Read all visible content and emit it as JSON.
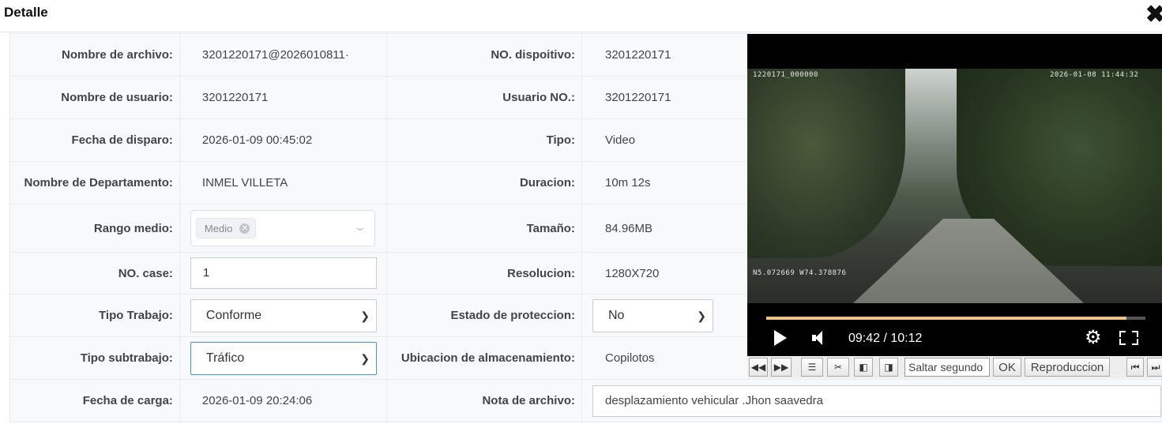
{
  "dialog": {
    "title": "Detalle",
    "close_icon": "close-icon"
  },
  "form": {
    "left": [
      {
        "label": "Nombre de archivo:",
        "value": "3201220171@2026010811·"
      },
      {
        "label": "Nombre de usuario:",
        "value": "3201220171"
      },
      {
        "label": "Fecha de disparo:",
        "value": "2026-01-09 00:45:02"
      },
      {
        "label": "Nombre de Departamento:",
        "value": "INMEL VILLETA"
      },
      {
        "label": "Rango medio:",
        "tag": "Medio"
      },
      {
        "label": "NO. case:",
        "value": "1"
      },
      {
        "label": "Tipo Trabajo:",
        "value": "Conforme"
      },
      {
        "label": "Tipo subtrabajo:",
        "value": "Tráfico"
      },
      {
        "label": "Fecha de carga:",
        "value": "2026-01-09 20:24:06"
      }
    ],
    "right": [
      {
        "label": "NO. dispoitivo:",
        "value": "3201220171"
      },
      {
        "label": "Usuario NO.:",
        "value": "3201220171"
      },
      {
        "label": "Tipo:",
        "value": "Video"
      },
      {
        "label": "Duracion:",
        "value": "10m 12s"
      },
      {
        "label": "Tamaño:",
        "value": "84.96MB"
      },
      {
        "label": "Resolucion:",
        "value": "1280X720"
      },
      {
        "label": "Estado de proteccion:",
        "value": "No"
      },
      {
        "label": "Ubicacion de almacenamiento:",
        "value": "Copilotos"
      },
      {
        "label": "Nota de archivo:",
        "value": "desplazamiento vehicular .Jhon saavedra"
      }
    ]
  },
  "video": {
    "osd_top_left": "1220171_000000",
    "osd_top_right": "2026-01-08 11:44:32",
    "osd_coords": "N5.072669 W74.378876",
    "time": "09:42 / 10:12",
    "progress": 0.951
  },
  "toolbar": {
    "seek_placeholder": "Saltar segundo",
    "ok_label": "OK",
    "replay_label": "Reproduccion"
  }
}
